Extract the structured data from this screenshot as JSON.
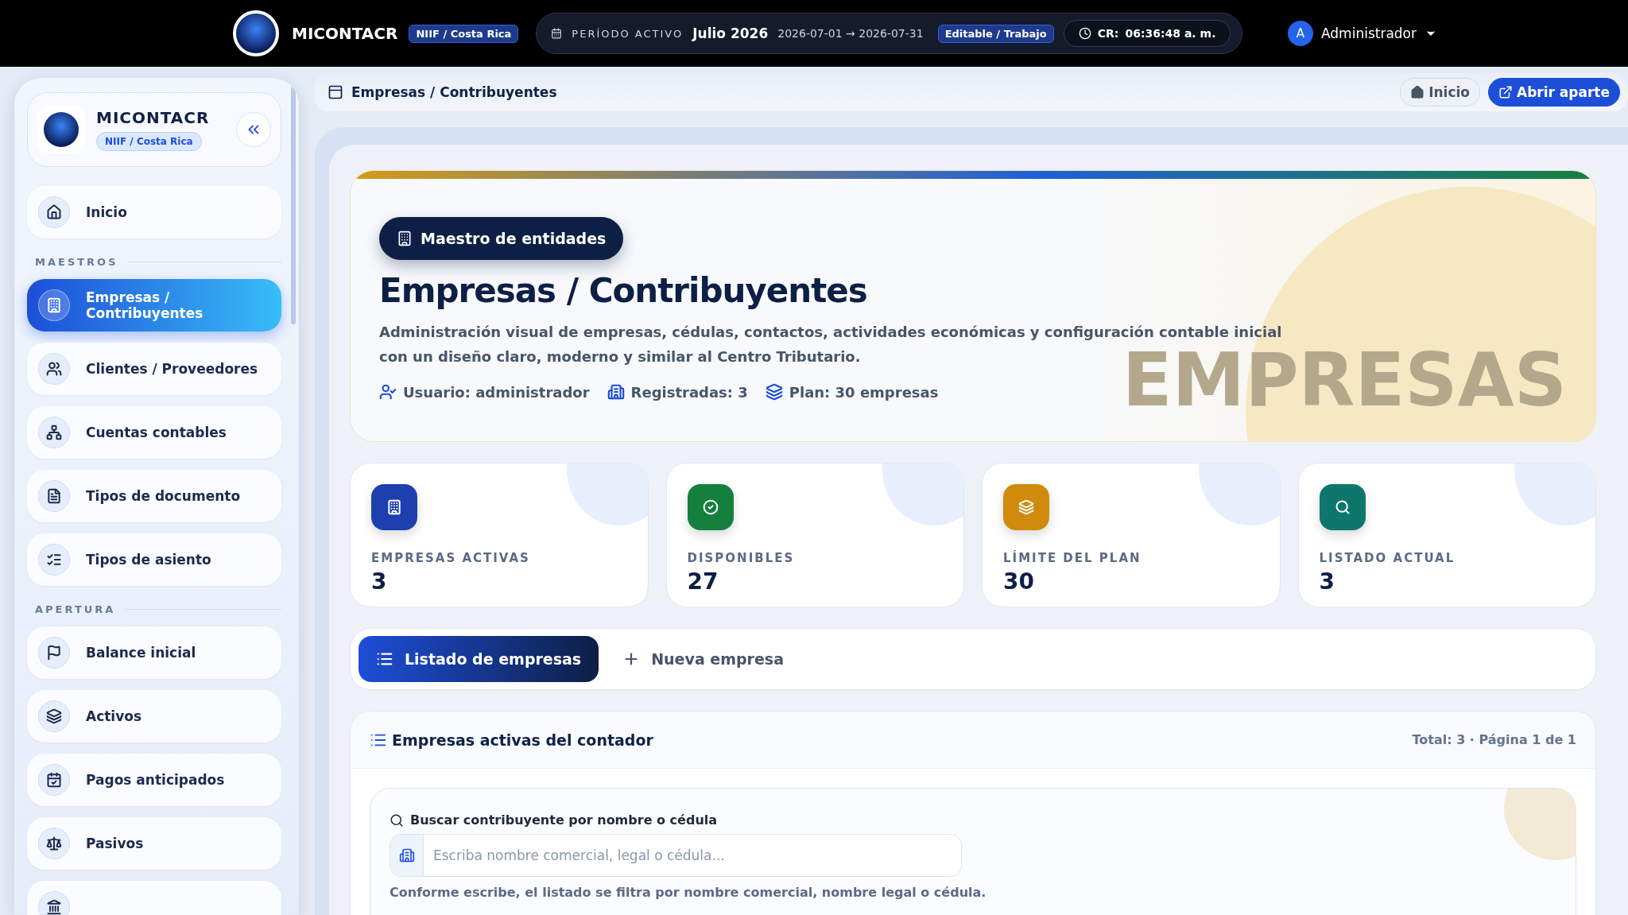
{
  "topbar": {
    "brand": "MICONTACR",
    "badge": "NIIF / Costa Rica",
    "period_label": "PERÍODO ACTIVO",
    "period": "Julio 2026",
    "range": "2026-07-01 → 2026-07-31",
    "mode": "Editable / Trabajo",
    "clock_label": "CR:",
    "clock": "06:36:48 a. m.",
    "user_initial": "A",
    "user": "Administrador"
  },
  "sidebar": {
    "brand": "MICONTACR",
    "badge": "NIIF / Costa Rica",
    "top_items": [
      {
        "label": "Inicio",
        "selected": false
      }
    ],
    "sections": [
      {
        "title": "MAESTROS",
        "items": [
          {
            "label": "Empresas / Contribuyentes",
            "selected": true
          },
          {
            "label": "Clientes / Proveedores",
            "selected": false
          },
          {
            "label": "Cuentas contables",
            "selected": false
          },
          {
            "label": "Tipos de documento",
            "selected": false
          },
          {
            "label": "Tipos de asiento",
            "selected": false
          }
        ]
      },
      {
        "title": "APERTURA",
        "items": [
          {
            "label": "Balance inicial",
            "selected": false
          },
          {
            "label": "Activos",
            "selected": false
          },
          {
            "label": "Pagos anticipados",
            "selected": false
          },
          {
            "label": "Pasivos",
            "selected": false
          },
          {
            "selected": false
          }
        ]
      }
    ]
  },
  "breadcrumb": {
    "title": "Empresas / Contribuyentes",
    "buttons": [
      {
        "label": "Inicio",
        "kind": "ghost"
      },
      {
        "label": "Abrir aparte",
        "kind": "primary"
      }
    ]
  },
  "hero": {
    "pill": "Maestro de entidades",
    "title": "Empresas / Contribuyentes",
    "description": "Administración visual de empresas, cédulas, contactos, actividades económicas y configuración contable inicial con un diseño claro, moderno y similar al Centro Tributario.",
    "meta": [
      "Usuario: administrador",
      "Registradas: 3",
      "Plan: 30 empresas"
    ],
    "watermark": "EMPRESAS"
  },
  "stats": [
    {
      "label": "EMPRESAS ACTIVAS",
      "value": "3",
      "color": "#1e40af"
    },
    {
      "label": "DISPONIBLES",
      "value": "27",
      "color": "#15803d"
    },
    {
      "label": "LÍMITE DEL PLAN",
      "value": "30",
      "color": "#d08a0c"
    },
    {
      "label": "LISTADO ACTUAL",
      "value": "3",
      "color": "#0f766e"
    }
  ],
  "tabs": [
    {
      "label": "Listado de empresas",
      "selected": true
    },
    {
      "label": "Nueva empresa",
      "selected": false
    }
  ],
  "list_card": {
    "title": "Empresas activas del contador",
    "summary": "Total: 3 · Página 1 de 1",
    "search_label": "Buscar contribuyente por nombre o cédula",
    "search_placeholder": "Escriba nombre comercial, legal o cédula...",
    "hint": "Conforme escribe, el listado se filtra por nombre comercial, nombre legal o cédula."
  }
}
